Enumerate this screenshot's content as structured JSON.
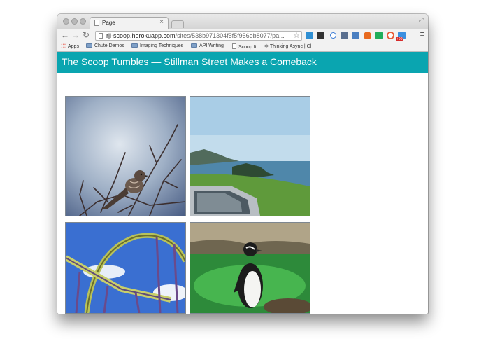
{
  "browser": {
    "tab_title": "Page",
    "tab_close": "×",
    "url_host": "rji-scoop.herokuapp.com",
    "url_path": "/sites/538b971304f5f5f956eb8077/pa...",
    "nav": {
      "back": "←",
      "forward": "→",
      "reload": "↻"
    },
    "star": "☆",
    "menu": "≡",
    "resize": "⤢",
    "extension_badge": "+99",
    "bookmarks": [
      {
        "label": "Apps",
        "icon": "apps-grid-icon"
      },
      {
        "label": "Chute Demos",
        "icon": "folder-icon"
      },
      {
        "label": "Imaging Techniques",
        "icon": "folder-icon"
      },
      {
        "label": "API Writing",
        "icon": "folder-icon"
      },
      {
        "label": "Scoop It",
        "icon": "page-icon"
      },
      {
        "label": "Thinking Async | Cl",
        "icon": "gear-icon"
      }
    ]
  },
  "page": {
    "title": "The Scoop Tumbles — Stillman Street Makes a Comeback"
  },
  "photos": [
    {
      "subject": "bird-on-branch"
    },
    {
      "subject": "coastal-view-from-car"
    },
    {
      "subject": "roller-coaster"
    },
    {
      "subject": "penguin"
    }
  ],
  "colors": {
    "banner": "#0aa5b0",
    "banner_text": "#ffffff"
  }
}
